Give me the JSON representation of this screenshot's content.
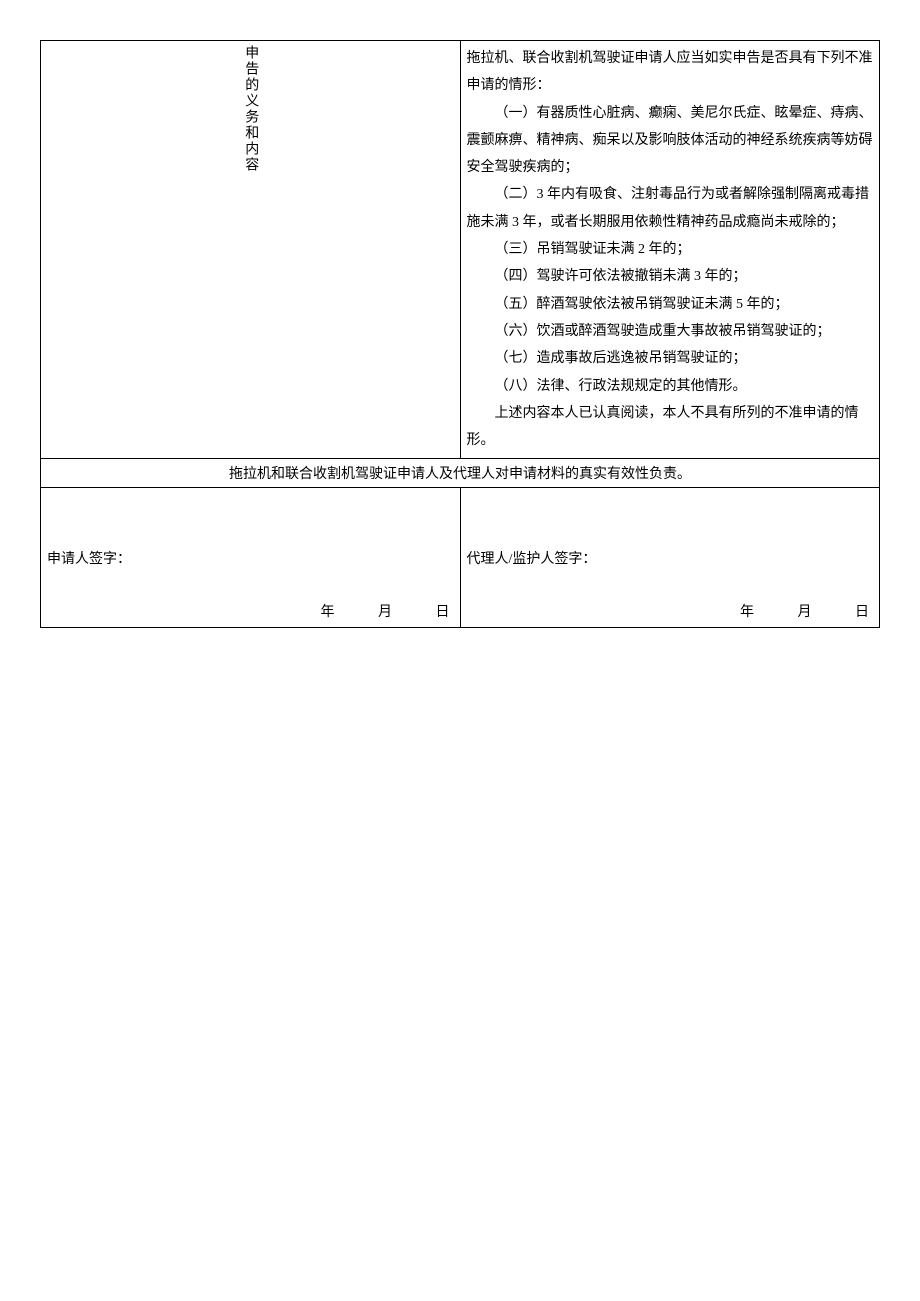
{
  "section": {
    "label": "申告的义务和内容",
    "intro": "拖拉机、联合收割机驾驶证申请人应当如实申告是否具有下列不准申请的情形：",
    "items": [
      "（一）有器质性心脏病、癫痫、美尼尔氏症、眩晕症、痔病、震颤麻痹、精神病、痴呆以及影响肢体活动的神经系统疾病等妨碍安全驾驶疾病的；",
      "（二）3 年内有吸食、注射毒品行为或者解除强制隔离戒毒措施未满 3 年，或者长期服用依赖性精神药品成瘾尚未戒除的；",
      "（三）吊销驾驶证未满 2 年的；",
      "（四）驾驶许可依法被撤销未满 3 年的；",
      "（五）醉酒驾驶依法被吊销驾驶证未满 5 年的；",
      "（六）饮酒或醉酒驾驶造成重大事故被吊销驾驶证的；",
      "（七）造成事故后逃逸被吊销驾驶证的；",
      "（八）法律、行政法规规定的其他情形。"
    ],
    "confirm": "上述内容本人已认真阅读，本人不具有所列的不准申请的情形。"
  },
  "notice": "拖拉机和联合收割机驾驶证申请人及代理人对申请材料的真实有效性负责。",
  "signatures": {
    "applicant_label": "申请人签字：",
    "agent_label": "代理人/监护人签字：",
    "year": "年",
    "month": "月",
    "day": "日"
  }
}
